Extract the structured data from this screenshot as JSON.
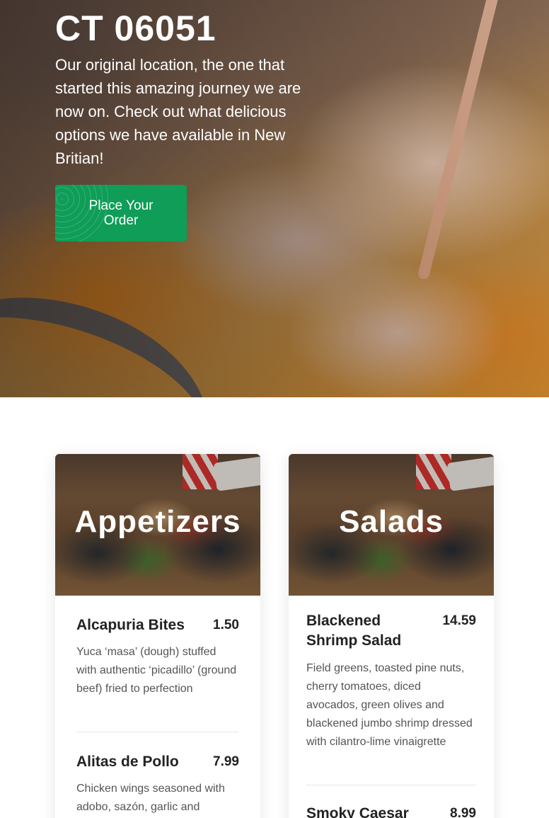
{
  "hero": {
    "title": "CT 06051",
    "description": "Our original location, the one that started this amazing journey we are now on. Check out what delicious options we have available in New Britian!",
    "order_button": "Place Your Order"
  },
  "menu": {
    "appetizers": {
      "title": "Appetizers",
      "items": [
        {
          "name": "Alcapuria Bites",
          "price": "1.50",
          "description": "Yuca ‘masa’ (dough) stuffed with authentic ‘picadillo’ (ground beef) fried to perfection"
        },
        {
          "name": "Alitas de Pollo",
          "price": "7.99",
          "description": "Chicken wings seasoned with adobo, sazón, garlic and"
        }
      ]
    },
    "salads": {
      "title": "Salads",
      "items": [
        {
          "name": "Blackened Shrimp Salad",
          "price": "14.59",
          "description": "Field greens, toasted pine nuts, cherry tomatoes, diced avocados, green olives and blackened jumbo shrimp dressed with cilantro-lime vinaigrette"
        },
        {
          "name": "Smoky Caesar",
          "price": "8.99",
          "description": ""
        }
      ]
    }
  }
}
